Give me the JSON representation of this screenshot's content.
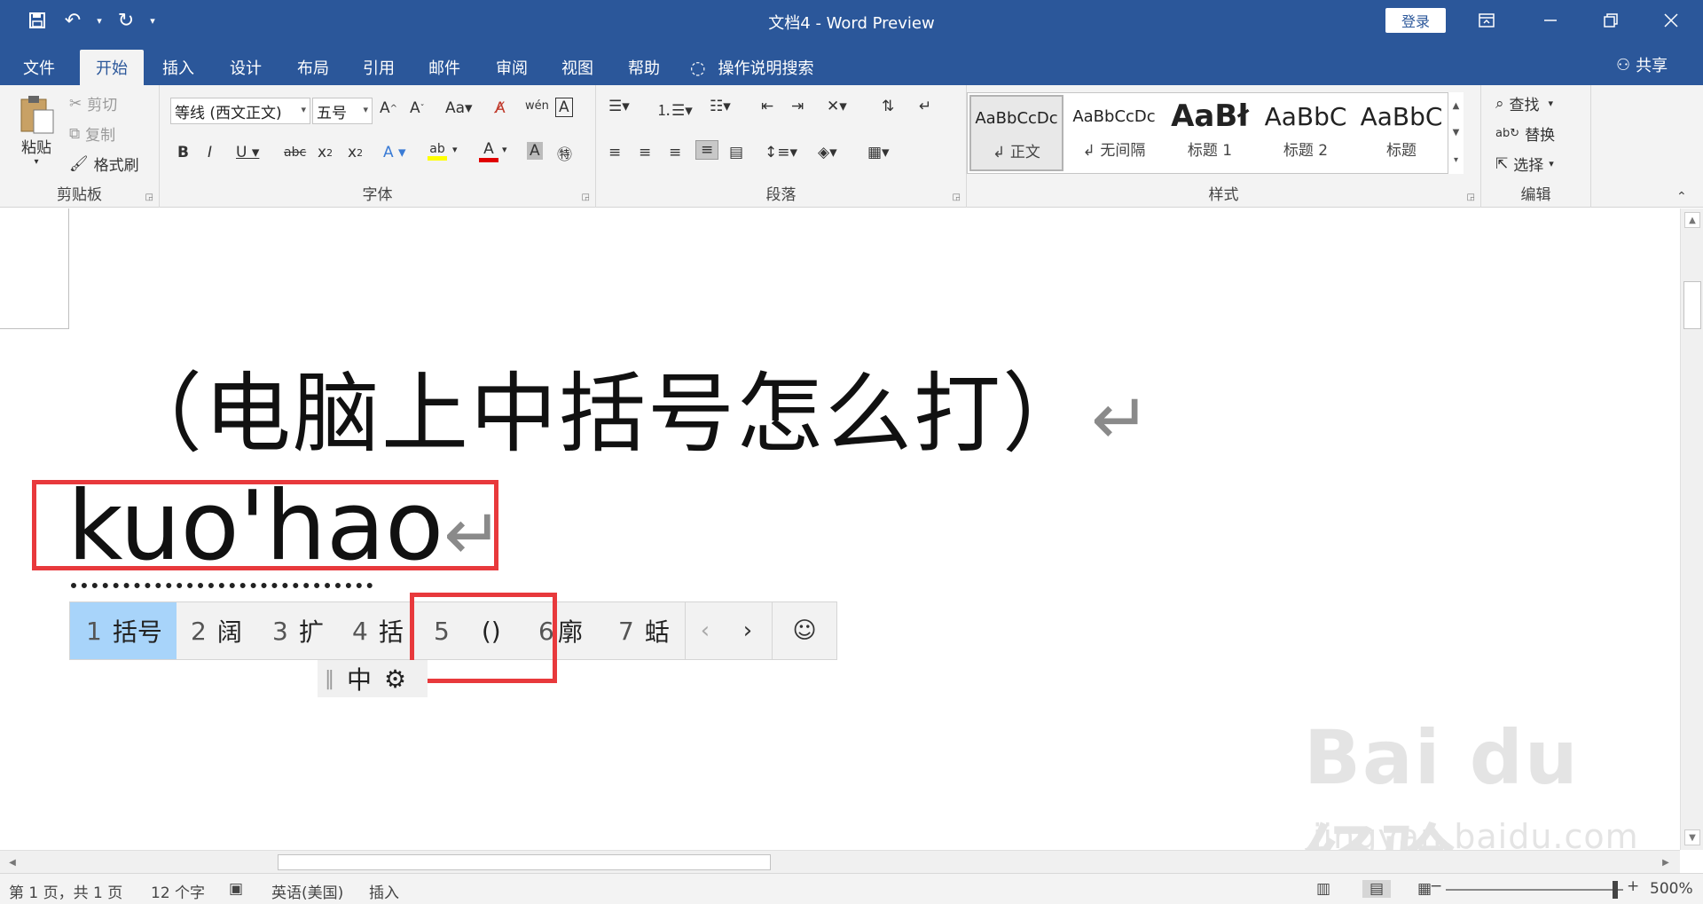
{
  "titlebar": {
    "title": "文档4  -  Word Preview",
    "login_label": "登录",
    "qat": {
      "save_icon": "save-icon",
      "undo_icon": "undo-icon",
      "redo_icon": "redo-icon"
    }
  },
  "tabs": [
    {
      "label": "文件"
    },
    {
      "label": "开始"
    },
    {
      "label": "插入"
    },
    {
      "label": "设计"
    },
    {
      "label": "布局"
    },
    {
      "label": "引用"
    },
    {
      "label": "邮件"
    },
    {
      "label": "审阅"
    },
    {
      "label": "视图"
    },
    {
      "label": "帮助"
    }
  ],
  "tell_me": "操作说明搜索",
  "share_label": "共享",
  "clipboard": {
    "paste": "粘贴",
    "cut": "剪切",
    "copy": "复制",
    "format_painter": "格式刷",
    "group": "剪贴板"
  },
  "font": {
    "family": "等线 (西文正文)",
    "size": "五号",
    "group": "字体"
  },
  "paragraph": {
    "group": "段落"
  },
  "styles": {
    "group": "样式",
    "items": [
      {
        "sample": "AaBbCcDc",
        "name": "↲ 正文"
      },
      {
        "sample": "AaBbCcDc",
        "name": "↲ 无间隔"
      },
      {
        "sample": "AaBł",
        "name": "标题 1"
      },
      {
        "sample": "AaBbC",
        "name": "标题 2"
      },
      {
        "sample": "AaBbC",
        "name": "标题"
      }
    ]
  },
  "editing": {
    "find": "查找",
    "replace": "替换",
    "select": "选择",
    "group": "编辑"
  },
  "document": {
    "heading": "（电脑上中括号怎么打）",
    "pilcrow": "↵",
    "typing": "kuo'hao",
    "typing_pilcrow": "↵"
  },
  "ime": {
    "candidates": [
      {
        "num": "1",
        "text": "括号"
      },
      {
        "num": "2",
        "text": "阔"
      },
      {
        "num": "3",
        "text": "扩"
      },
      {
        "num": "4",
        "text": "括"
      },
      {
        "num": "5",
        "text": "()"
      },
      {
        "num": "6",
        "text": "廓"
      },
      {
        "num": "7",
        "text": "蛞"
      }
    ],
    "prev": "‹",
    "next": "›",
    "emoji": "☺",
    "status_mode": "中",
    "status_sep": "‖"
  },
  "watermark": {
    "brand": "Bai du 经验",
    "url": "jingyan.baidu.com"
  },
  "statusbar": {
    "page": "第 1 页，共 1 页",
    "words": "12 个字",
    "language": "英语(美国)",
    "mode": "插入",
    "zoom": "500%"
  },
  "colors": {
    "brand": "#2b579a",
    "highlight": "#a8d4fa",
    "annotation": "#e8393c"
  }
}
